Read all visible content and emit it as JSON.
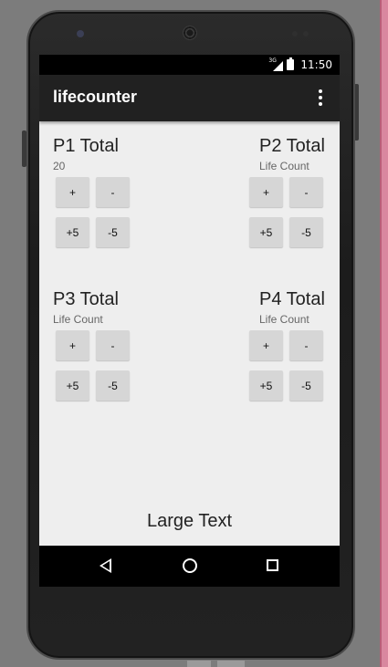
{
  "status_bar": {
    "network": "3G",
    "time": "11:50"
  },
  "app_bar": {
    "title": "lifecounter",
    "overflow_icon": "more-vert-icon"
  },
  "players": [
    {
      "title": "P1 Total",
      "life": "20"
    },
    {
      "title": "P2 Total",
      "life": "Life Count"
    },
    {
      "title": "P3 Total",
      "life": "Life Count"
    },
    {
      "title": "P4 Total",
      "life": "Life Count"
    }
  ],
  "buttons": {
    "plus": "+",
    "minus": "-",
    "plus5": "+5",
    "minus5": "-5"
  },
  "footer": {
    "large_text": "Large Text"
  },
  "nav_bar": {
    "icons": [
      "back-icon",
      "home-icon",
      "recent-apps-icon"
    ]
  }
}
